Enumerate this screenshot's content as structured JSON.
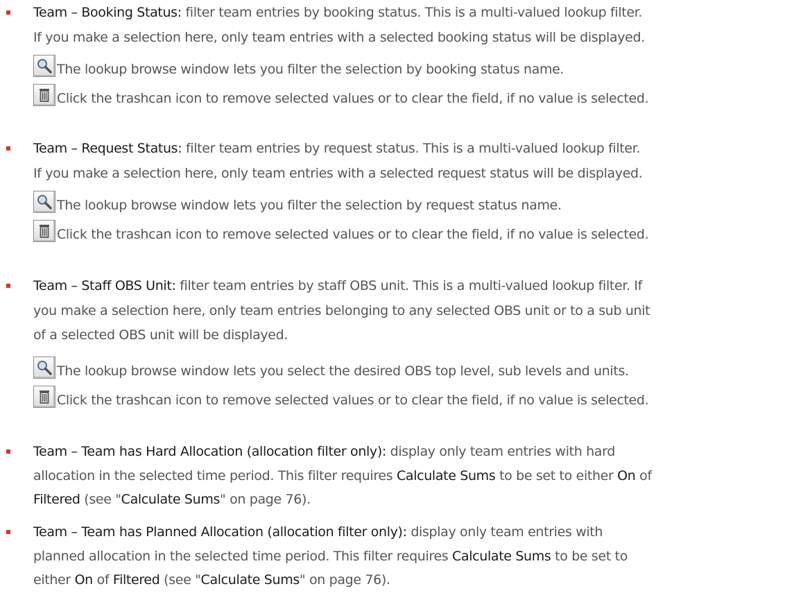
{
  "items": [
    {
      "term": "Team – Booking Status:",
      "line1_rest": " filter team entries by booking status. This is a multi-valued lookup filter.",
      "line2": "If you make a selection here, only team entries with a selected booking status will be displayed.",
      "lookup_text": "The lookup browse window lets you filter the selection by booking status name.",
      "trash_text": "Click the trashcan icon to remove selected values or to clear the field, if no value is selected."
    },
    {
      "term": "Team – Request Status:",
      "line1_rest": " filter team entries by request status. This is a multi-valued lookup filter.",
      "line2": "If you make a selection here, only team entries with a selected request status will be displayed.",
      "lookup_text": "The lookup browse window lets you filter the selection by request status name.",
      "trash_text": "Click the trashcan icon to remove selected values or to clear the field, if no value is selected."
    },
    {
      "term": "Team – Staff OBS Unit:",
      "line1_rest": " filter team entries by staff OBS unit. This is a multi-valued lookup filter. If",
      "line2": "you make a selection here, only team entries belonging to any selected OBS unit or to a sub unit",
      "line3": "of a selected OBS unit will be displayed.",
      "lookup_text": "The lookup browse window lets you select the desired OBS top level, sub levels and units.",
      "trash_text": "Click the trashcan icon to remove selected values or to clear the field, if no value is selected."
    },
    {
      "term": "Team – Team has Hard Allocation (allocation filter only):",
      "line1_rest": " display only team entries with hard",
      "line2_a": "allocation in the selected time period. This filter requires ",
      "kw_calc": "Calculate Sums",
      "line2_b": " to be set to either ",
      "kw_on": "On",
      "line2_c": " of",
      "kw_filtered": "Filtered",
      "line3_a": " (see \"",
      "line3_b": "\" on page 76)."
    },
    {
      "term": "Team – Team has Planned Allocation (allocation filter only):",
      "line1_rest": " display only team entries with",
      "line2_a": "planned allocation in the selected time period. This filter requires ",
      "kw_calc": "Calculate Sums",
      "line2_b": " to be set to",
      "line3_a": "either ",
      "kw_on": "On",
      "line3_b": " of ",
      "kw_filtered": "Filtered",
      "line3_c": " (see \"",
      "line3_d": "\" on page 76)."
    }
  ]
}
